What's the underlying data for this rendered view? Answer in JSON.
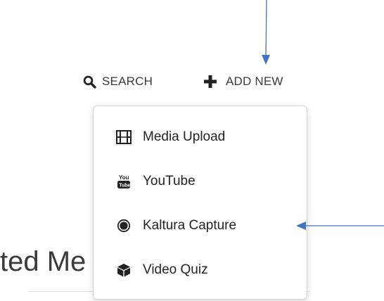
{
  "toolbar": {
    "search_label": "SEARCH",
    "add_new_label": "ADD NEW"
  },
  "page": {
    "heading_partial": "ted Me"
  },
  "add_new_menu": {
    "items": [
      {
        "label": "Media Upload",
        "icon": "film-icon"
      },
      {
        "label": "YouTube",
        "icon": "youtube-icon"
      },
      {
        "label": "Kaltura Capture",
        "icon": "record-icon"
      },
      {
        "label": "Video Quiz",
        "icon": "cube-icon"
      }
    ]
  },
  "colors": {
    "annotation_arrow": "#4472c4",
    "text": "#222222",
    "menu_border": "#d2d2d2"
  }
}
